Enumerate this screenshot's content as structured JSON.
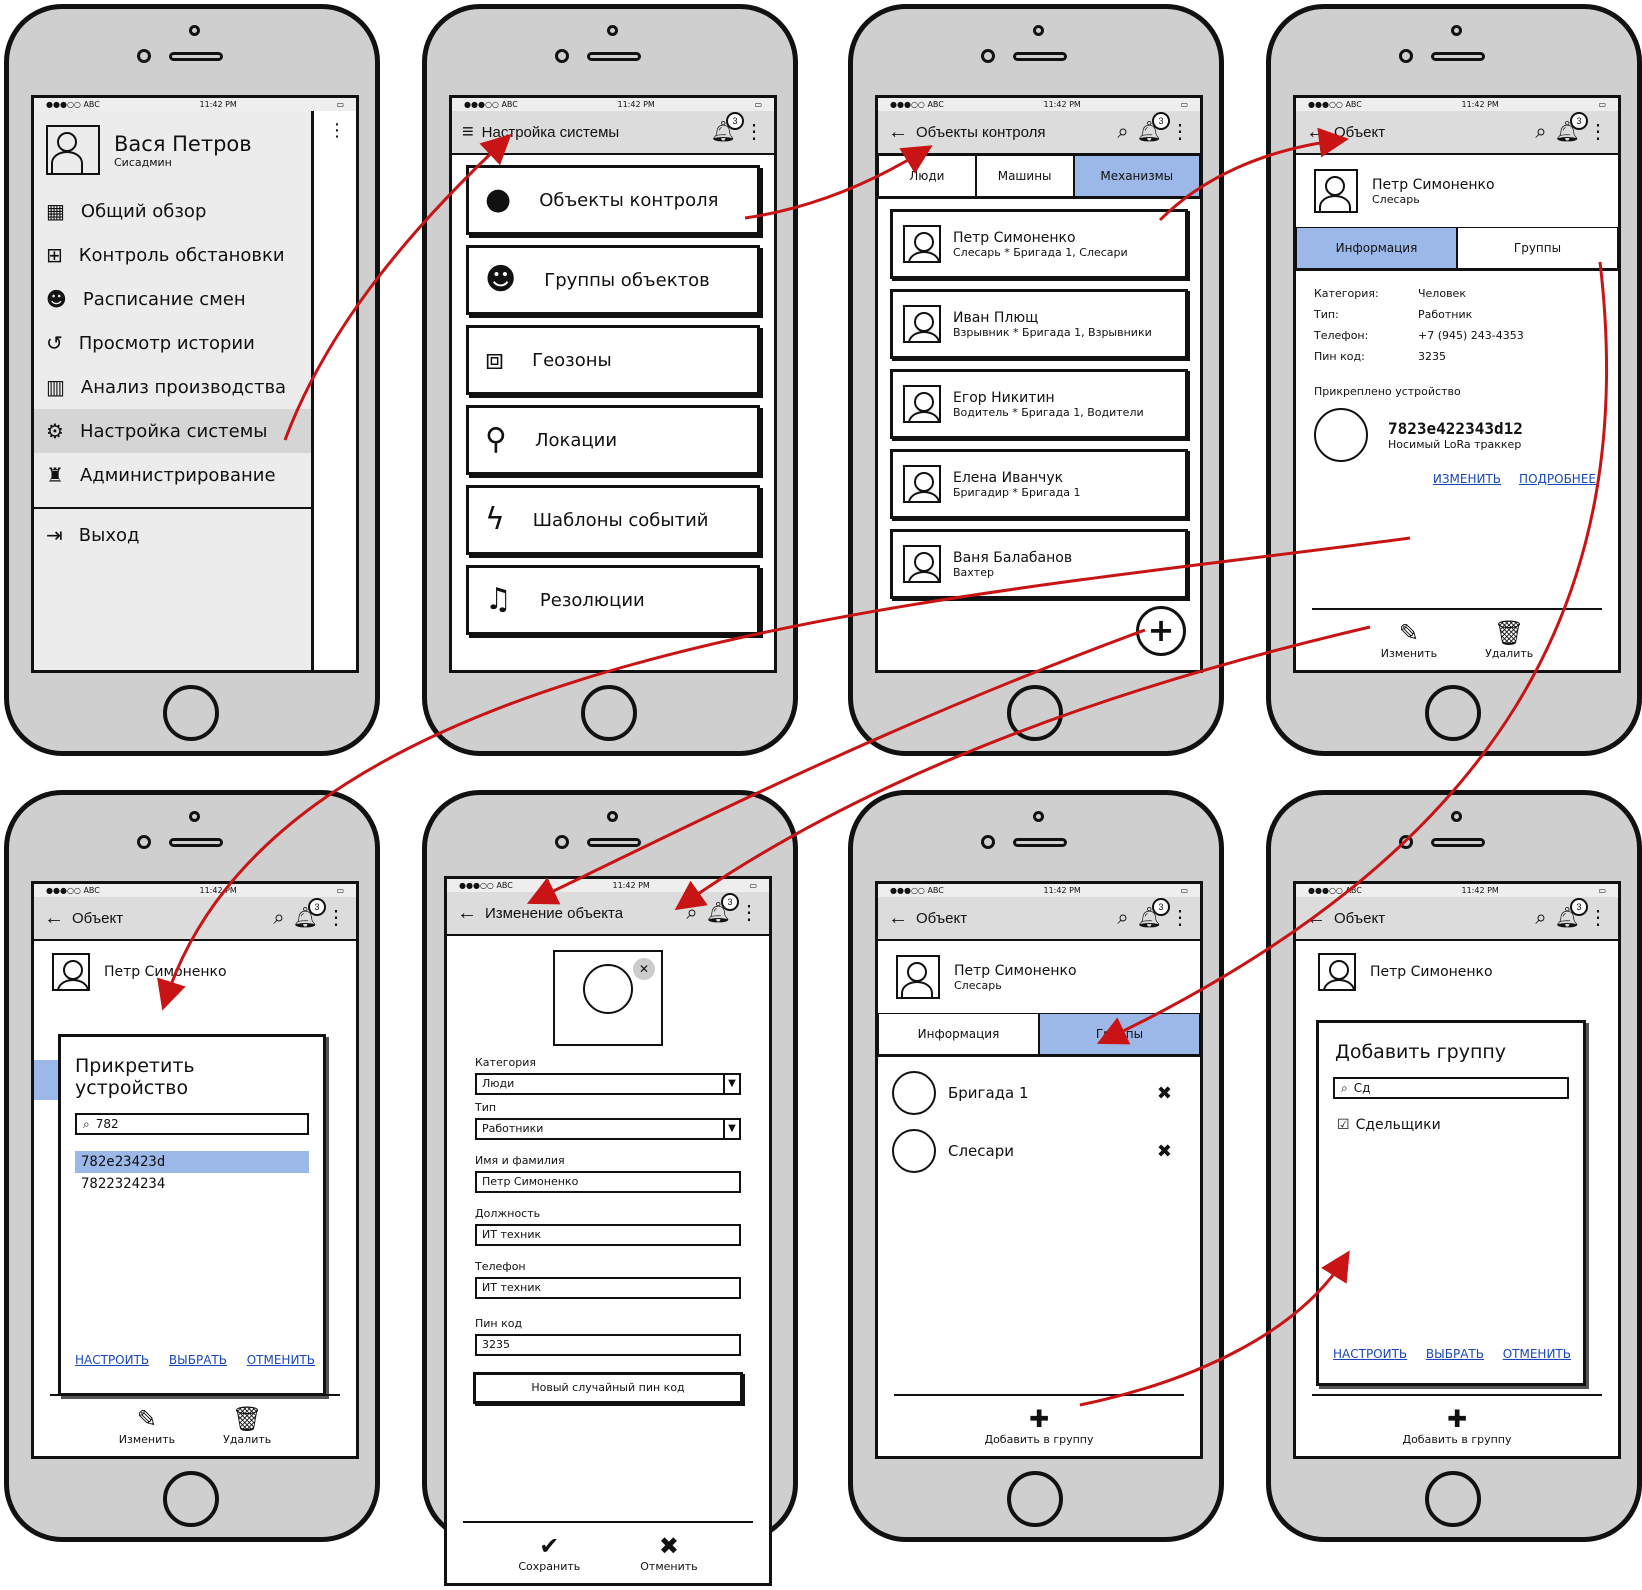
{
  "status": {
    "carrier": "●●●○○ ABC",
    "time": "11:42 PM"
  },
  "p1": {
    "user_name": "Вася Петров",
    "user_role": "Сисадмин",
    "menu": [
      {
        "label": "Общий обзор",
        "icon": "dashboard-icon"
      },
      {
        "label": "Контроль обстановки",
        "icon": "binoculars-icon"
      },
      {
        "label": "Расписание смен",
        "icon": "users-icon"
      },
      {
        "label": "Просмотр истории",
        "icon": "history-icon"
      },
      {
        "label": "Анализ производства",
        "icon": "bar-chart-icon"
      },
      {
        "label": "Настройка системы",
        "icon": "gears-icon"
      },
      {
        "label": "Администрирование",
        "icon": "admin-icon"
      }
    ],
    "logout": "Выход"
  },
  "p2": {
    "title": "Настройка системы",
    "badge": "3",
    "cards": [
      "Объекты контроля",
      "Группы объектов",
      "Геозоны",
      "Локации",
      "Шаблоны событий",
      "Резолюции"
    ]
  },
  "p3": {
    "title": "Объекты контроля",
    "badge": "3",
    "tabs": [
      "Люди",
      "Машины",
      "Механизмы"
    ],
    "people": [
      {
        "name": "Петр Симоненко",
        "sub": "Слесарь * Бригада 1, Слесари"
      },
      {
        "name": "Иван Плющ",
        "sub": "Взрывник * Бригада 1, Взрывники"
      },
      {
        "name": "Егор Никитин",
        "sub": "Водитель * Бригада 1, Водители"
      },
      {
        "name": "Елена Иванчук",
        "sub": "Бригадир * Бригада 1"
      },
      {
        "name": "Ваня Балабанов",
        "sub": "Вахтер"
      }
    ]
  },
  "p4": {
    "title": "Объект",
    "badge": "3",
    "name": "Петр Симоненко",
    "role": "Слесарь",
    "tabs": [
      "Информация",
      "Группы"
    ],
    "fields": [
      {
        "k": "Категория:",
        "v": "Человек"
      },
      {
        "k": "Тип:",
        "v": "Работник"
      },
      {
        "k": "Телефон:",
        "v": "+7 (945) 243-4353"
      },
      {
        "k": "Пин код:",
        "v": "3235"
      }
    ],
    "attached": "Прикреплено устройство",
    "device_id": "7823e422343d12",
    "device_name": "Носимый LoRa траккер",
    "change": "ИЗМЕНИТЬ",
    "more": "ПОДРОБНЕЕ",
    "edit": "Изменить",
    "delete": "Удалить"
  },
  "p5": {
    "title": "Объект",
    "badge": "3",
    "name": "Петр Симоненко",
    "modal_title": "Прикретить устройство",
    "search": "782",
    "results": [
      "782e23423d",
      "7822324234"
    ],
    "actions": [
      "НАСТРОИТЬ",
      "ВЫБРАТЬ",
      "ОТМЕНИТЬ"
    ],
    "edit": "Изменить",
    "delete": "Удалить"
  },
  "p6": {
    "title": "Изменение объекта",
    "badge": "3",
    "category_label": "Категория",
    "category": "Люди",
    "type_label": "Тип",
    "type": "Работники",
    "name_label": "Имя и фамилия",
    "name": "Петр Симоненко",
    "position_label": "Должность",
    "position": "ИТ техник",
    "phone_label": "Телефон",
    "phone": "ИТ техник",
    "pin_label": "Пин код",
    "pin": "3235",
    "random_pin": "Новый случайный пин код",
    "save": "Сохранить",
    "cancel": "Отменить"
  },
  "p7": {
    "title": "Объект",
    "badge": "3",
    "name": "Петр Симоненко",
    "role": "Слесарь",
    "tabs": [
      "Информация",
      "Группы"
    ],
    "groups": [
      "Бригада 1",
      "Слесари"
    ],
    "add": "Добавить в группу"
  },
  "p8": {
    "title": "Объект",
    "badge": "3",
    "name": "Петр Симоненко",
    "modal_title": "Добавить группу",
    "search": "Сд",
    "checkbox": "Сдельщики",
    "actions": [
      "НАСТРОИТЬ",
      "ВЫБРАТЬ",
      "ОТМЕНИТЬ"
    ],
    "add": "Добавить в группу"
  },
  "colors": {
    "accent": "#9cb8e8",
    "arrow": "#c81414",
    "link": "#1a47b8"
  }
}
